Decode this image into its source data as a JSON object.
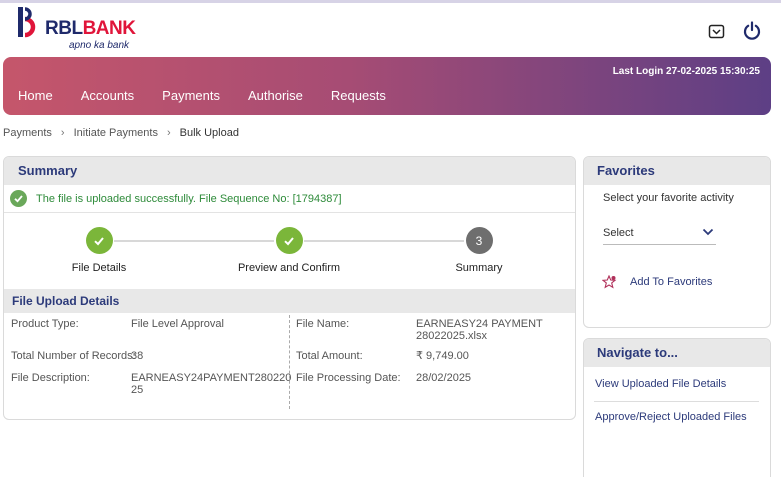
{
  "brand": {
    "name_part1": "RBL",
    "name_part2": "BANK",
    "tagline": "apno ka bank"
  },
  "header": {
    "last_login": "Last Login 27-02-2025 15:30:25",
    "icons": [
      "mail-icon",
      "power-icon"
    ]
  },
  "nav": {
    "items": [
      "Home",
      "Accounts",
      "Payments",
      "Authorise",
      "Requests"
    ]
  },
  "breadcrumb": {
    "items": [
      "Payments",
      "Initiate Payments",
      "Bulk Upload"
    ]
  },
  "summary": {
    "title": "Summary",
    "success_message": "The file is uploaded successfully. File Sequence No: [1794387]",
    "steps": [
      {
        "label": "File Details",
        "status": "done"
      },
      {
        "label": "Preview and Confirm",
        "status": "done"
      },
      {
        "label": "Summary",
        "status": "current",
        "number": "3"
      }
    ]
  },
  "file_upload": {
    "title": "File Upload Details",
    "product_type_label": "Product Type:",
    "product_type": "File Level Approval",
    "total_records_label": "Total Number of Records:",
    "total_records": "38",
    "description_label": "File Description:",
    "description_line1": "EARNEASY24PAYMENT280220",
    "description_line2": "25",
    "file_name_label": "File Name:",
    "file_name_line1": "EARNEASY24 PAYMENT",
    "file_name_line2": "28022025.xlsx",
    "total_amount_label": "Total Amount:",
    "total_amount": "₹ 9,749.00",
    "processing_date_label": "File Processing Date:",
    "processing_date": "28/02/2025"
  },
  "favorites": {
    "title": "Favorites",
    "subtitle": "Select your favorite activity",
    "select_value": "Select",
    "add_label": "Add To Favorites"
  },
  "navigate": {
    "title": "Navigate to...",
    "links": [
      "View Uploaded File Details",
      "Approve/Reject Uploaded Files"
    ]
  },
  "colors": {
    "accent": "#2c3a7a",
    "success": "#2e8b3a",
    "step_done": "#7bb63a",
    "brand_red": "#e0153a"
  }
}
